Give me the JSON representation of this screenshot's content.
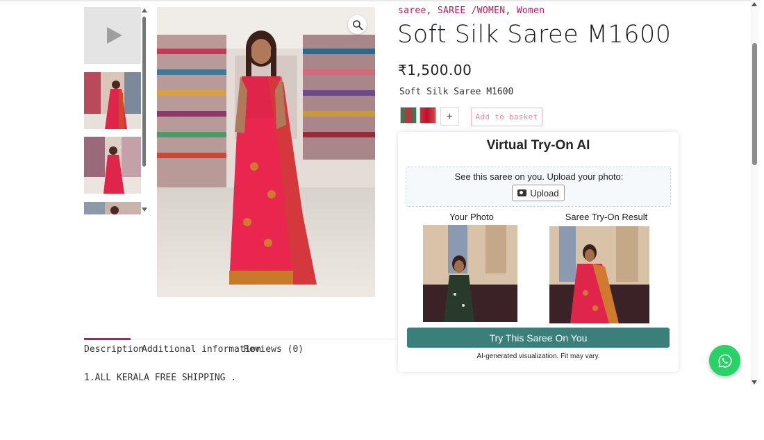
{
  "breadcrumb": {
    "categories": [
      "saree",
      "SAREE /WOMEN",
      "Women"
    ]
  },
  "product": {
    "title": "Soft Silk Saree M1600",
    "price": "₹1,500.00",
    "variant_name": "Soft Silk Saree M1600",
    "qty_button": "+",
    "add_to_basket": "Add to basket"
  },
  "tryon": {
    "title": "Virtual Try-On AI",
    "prompt": "See this saree on you. Upload your photo:",
    "upload_label": "Upload",
    "your_photo_label": "Your Photo",
    "result_label": "Saree Try-On Result",
    "try_button": "Try This Saree On You",
    "disclaimer": "AI-generated visualization. Fit may vary."
  },
  "tabs": [
    {
      "label": "Description",
      "active": true
    },
    {
      "label": "Additional information",
      "active": false
    },
    {
      "label": "Reviews (0)",
      "active": false
    }
  ],
  "description": {
    "first_line": "1.ALL KERALA FREE SHIPPING ."
  },
  "icons": {
    "play": "play-icon",
    "zoom": "magnifier-icon",
    "camera": "camera-icon",
    "whatsapp": "whatsapp-icon"
  },
  "colors": {
    "accent": "#c2185b",
    "tryon_button": "#3a7f7a",
    "whatsapp": "#25d366"
  }
}
